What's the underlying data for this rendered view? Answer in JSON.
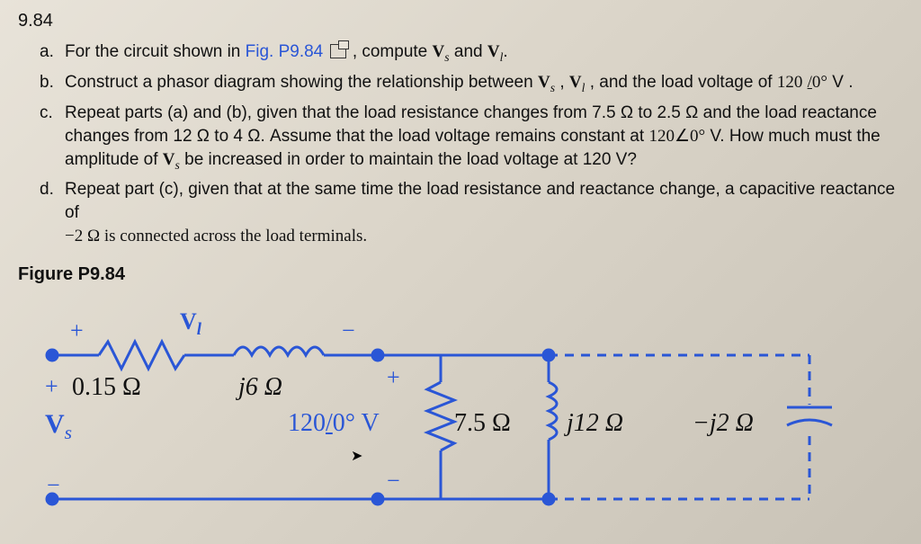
{
  "problem": {
    "number": "9.84",
    "items": {
      "a": {
        "pre": "For the circuit shown in ",
        "fig": "Fig. P9.84",
        "post": ", compute ",
        "v1": "V",
        "s1": "s",
        "and": " and ",
        "v2": "V",
        "s2": "l",
        "dot": "."
      },
      "b": "Construct a phasor diagram showing the relationship between Vₛ, V_l, and the load voltage of 120 /0° V .",
      "b_pre": "Construct a phasor diagram showing the relationship between ",
      "b_vs": "V",
      "b_vs_s": "s",
      "b_mid1": ", ",
      "b_vl": "V",
      "b_vl_s": "l",
      "b_mid2": ", and the load voltage of ",
      "b_val": "120",
      "b_ang": "0°",
      "b_unit": " V .",
      "c_l1": "Repeat parts (a) and (b), given that the load resistance changes from 7.5 Ω to 2.5 Ω and the load reactance",
      "c_l2a": "changes from 12 Ω to 4 Ω. Assume that the load voltage remains constant at ",
      "c_ang": "120∠0°",
      "c_l2b": " V. How much must the",
      "c_l3a": "amplitude of ",
      "c_vs": "V",
      "c_vs_s": "s",
      "c_l3b": " be increased in order to maintain the load voltage at 120 V?",
      "d_l1": "Repeat part (c), given that at the same time the load resistance and reactance change, a capacitive reactance of",
      "d_l2": "−2 Ω is connected across the load terminals."
    },
    "figure_label": "Figure P9.84"
  },
  "circuit": {
    "plus_top_left": "+",
    "Vl": "V",
    "Vl_sub": "l",
    "minus_top_right": "−",
    "plus_src": "+",
    "minus_src": "−",
    "plus_load": "+",
    "minus_load": "−",
    "R_line": "0.15 Ω",
    "X_line": "j6 Ω",
    "Vs": "V",
    "Vs_sub": "s",
    "V_load": "120",
    "V_load_ang": "0°",
    "V_load_unit": " V",
    "R_load": "7.5 Ω",
    "L_load": "j12 Ω",
    "C_load": "−j2 Ω"
  }
}
